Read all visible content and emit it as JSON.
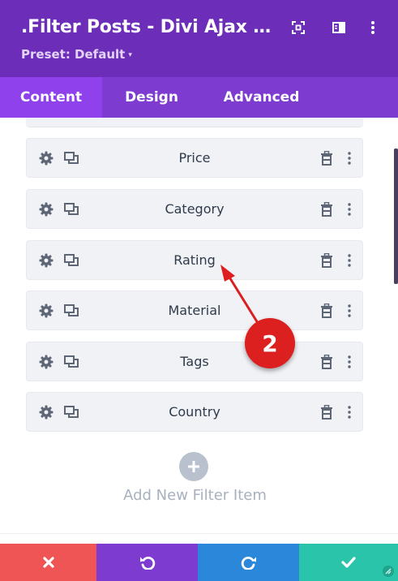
{
  "header": {
    "title": ".Filter Posts - Divi Ajax Filter Module",
    "preset_label": "Preset: Default",
    "caret": "▾",
    "icons": [
      "expand-icon",
      "sidebar-toggle-icon",
      "more-vertical-icon"
    ]
  },
  "tabs": [
    {
      "label": "Content",
      "active": true
    },
    {
      "label": "Design",
      "active": false
    },
    {
      "label": "Advanced",
      "active": false
    }
  ],
  "filter_items": [
    {
      "label": "Price"
    },
    {
      "label": "Category"
    },
    {
      "label": "Rating"
    },
    {
      "label": "Material"
    },
    {
      "label": "Tags"
    },
    {
      "label": "Country"
    }
  ],
  "item_icons": [
    "gear-icon",
    "duplicate-icon",
    "trash-icon",
    "more-vertical-icon"
  ],
  "add": {
    "plus": "+",
    "label": "Add New Filter Item"
  },
  "annotation": {
    "number": "2",
    "color": "#dc1f1f"
  },
  "footer": [
    {
      "name": "cancel",
      "icon": "close-icon",
      "color": "#ef5555"
    },
    {
      "name": "undo",
      "icon": "undo-icon",
      "color": "#7e3bd0"
    },
    {
      "name": "redo",
      "icon": "redo-icon",
      "color": "#2b87da"
    },
    {
      "name": "save",
      "icon": "check-icon",
      "color": "#29c4a9"
    }
  ],
  "colors": {
    "header": "#6c2eb9",
    "tabs": "#7d3bcf",
    "active_tab": "#8f42ec",
    "item_bg": "#f0f2f6"
  }
}
